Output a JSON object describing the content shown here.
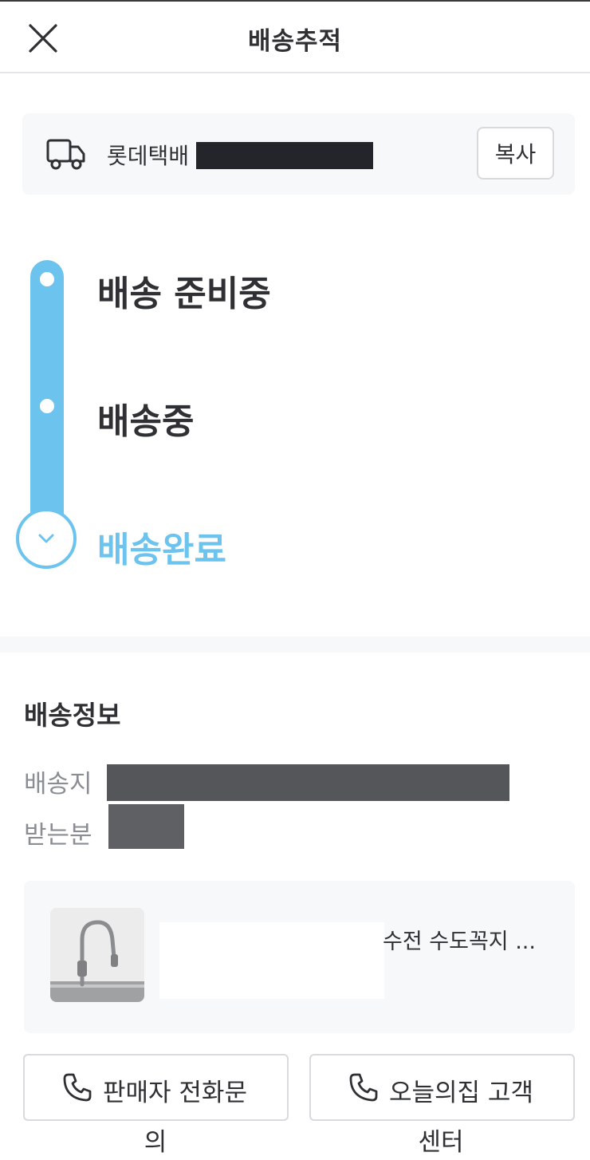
{
  "header": {
    "title": "배송추적",
    "close_icon": "close-icon"
  },
  "courier": {
    "name": "롯데택배",
    "copy_label": "복사",
    "icon": "truck-icon"
  },
  "progress": {
    "steps": [
      {
        "label": "배송 준비중",
        "state": "done"
      },
      {
        "label": "배송중",
        "state": "done"
      },
      {
        "label": "배송완료",
        "state": "current"
      }
    ],
    "accent_color": "#6cc4ee"
  },
  "delivery_info": {
    "title": "배송정보",
    "address_label": "배송지",
    "recipient_label": "받는분"
  },
  "product": {
    "name": "수전 수도꼭지 ..."
  },
  "actions": {
    "seller_call_line1": "판매자 전화문",
    "seller_call_line2": "의",
    "support_call_line1": "오늘의집 고객",
    "support_call_line2": "센터",
    "icon": "phone-icon"
  }
}
